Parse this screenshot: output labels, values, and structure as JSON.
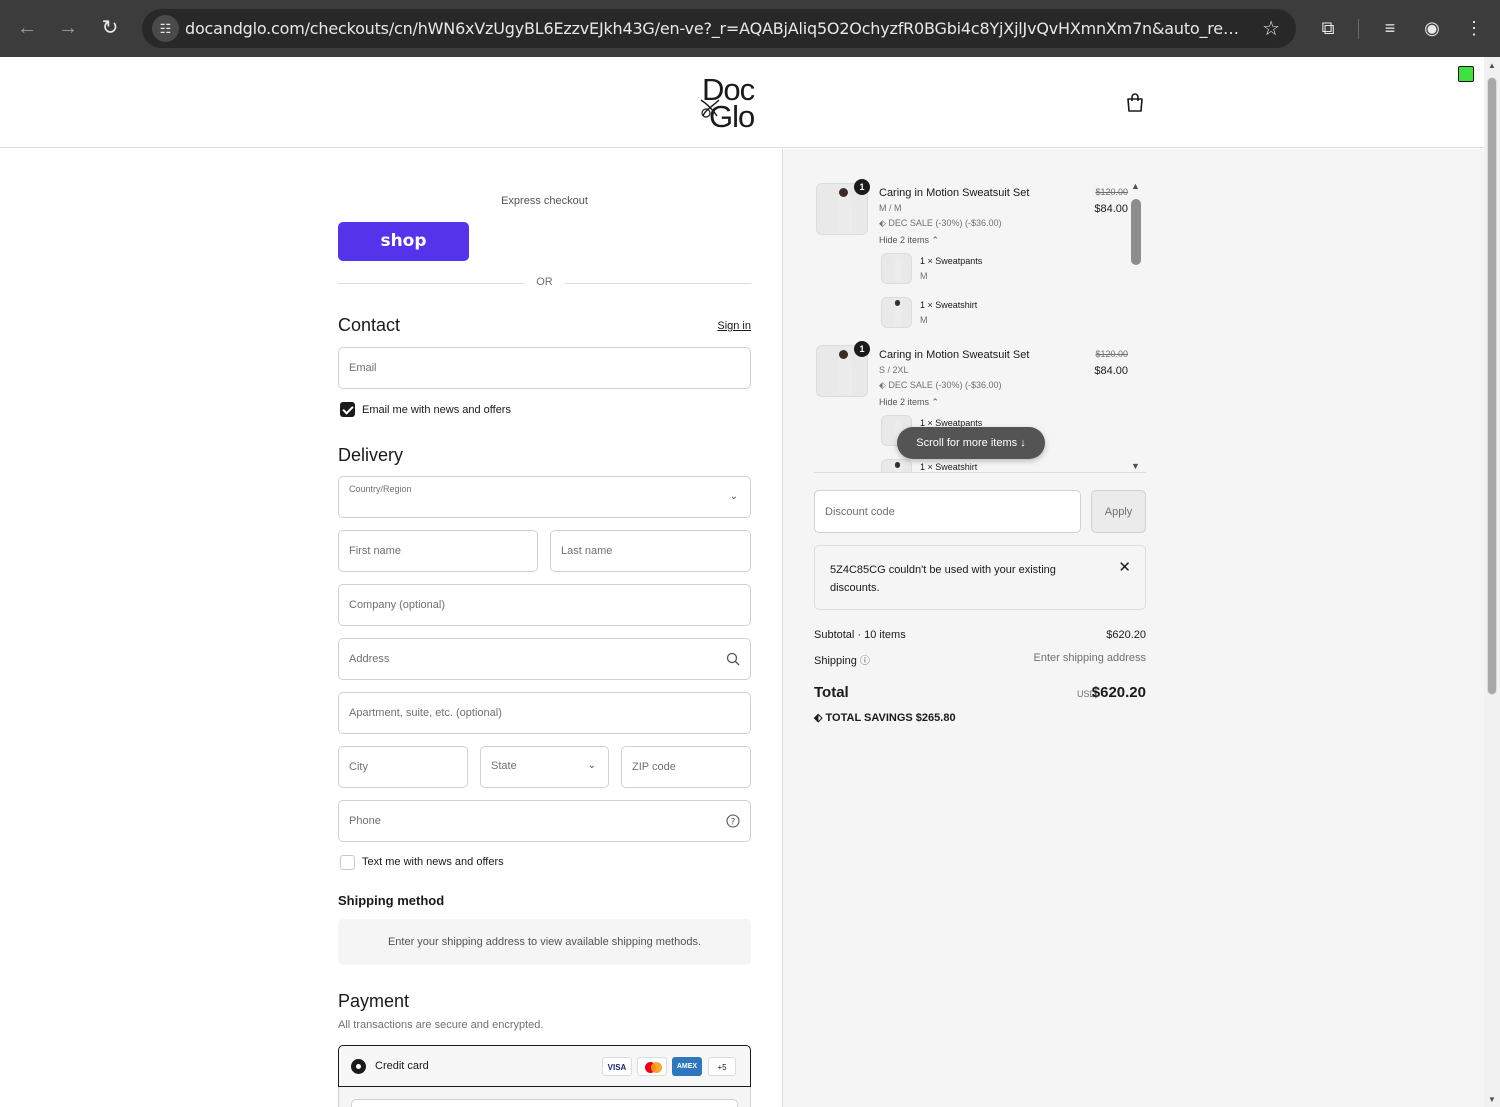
{
  "browser": {
    "url": "docandglo.com/checkouts/cn/hWN6xVzUgyBL6EzzvEJkh43G/en-ve?_r=AQABjAliq5O2OchyzfR0BGbi4c8YjXjlJvQvHXmnXm7n&auto_redirect=fals..."
  },
  "brand": {
    "line1": "Doc",
    "line2": "Glo"
  },
  "checkout": {
    "express_label": "Express checkout",
    "shop_label": "shop",
    "or_label": "OR",
    "contact_title": "Contact",
    "sign_in": "Sign in",
    "email_placeholder": "Email",
    "email_opt_in": "Email me with news and offers",
    "delivery_title": "Delivery",
    "country_label": "Country/Region",
    "first_name": "First name",
    "last_name": "Last name",
    "company": "Company (optional)",
    "address": "Address",
    "apartment": "Apartment, suite, etc. (optional)",
    "city": "City",
    "state": "State",
    "zip": "ZIP code",
    "phone": "Phone",
    "text_opt_in": "Text me with news and offers",
    "shipping_method_title": "Shipping method",
    "shipping_method_msg": "Enter your shipping address to view available shipping methods.",
    "payment_title": "Payment",
    "payment_sub": "All transactions are secure and encrypted.",
    "credit_card": "Credit card",
    "cards": [
      "VISA",
      "",
      "AMEX",
      "+5"
    ]
  },
  "summary": {
    "items": [
      {
        "qty": "1",
        "title": "Caring in Motion Sweatsuit Set",
        "variant": "M / M",
        "discount": "DEC SALE (-30%) (-$36.00)",
        "toggle": "Hide 2 items",
        "old_price": "$120.00",
        "price": "$84.00",
        "components": [
          {
            "name": "1 × Sweatpants",
            "variant": "M"
          },
          {
            "name": "1 × Sweatshirt",
            "variant": "M"
          }
        ]
      },
      {
        "qty": "1",
        "title": "Caring in Motion Sweatsuit Set",
        "variant": "S / 2XL",
        "discount": "DEC SALE (-30%) (-$36.00)",
        "toggle": "Hide 2 items",
        "old_price": "$120.00",
        "price": "$84.00",
        "components": [
          {
            "name": "1 × Sweatpants",
            "variant": ""
          },
          {
            "name": "1 × Sweatshirt",
            "variant": ""
          }
        ]
      }
    ],
    "scroll_hint": "Scroll for more items",
    "discount_placeholder": "Discount code",
    "apply": "Apply",
    "notice": "5Z4C85CG couldn't be used with your existing discounts.",
    "subtotal_label": "Subtotal · 10 items",
    "subtotal_value": "$620.20",
    "shipping_label": "Shipping",
    "shipping_value": "Enter shipping address",
    "total_label": "Total",
    "currency": "USD",
    "total_value": "$620.20",
    "savings_label": "TOTAL SAVINGS",
    "savings_value": "$265.80"
  },
  "colors": {
    "shop_pay": "#5433eb",
    "indicator": "#3ee13e"
  }
}
